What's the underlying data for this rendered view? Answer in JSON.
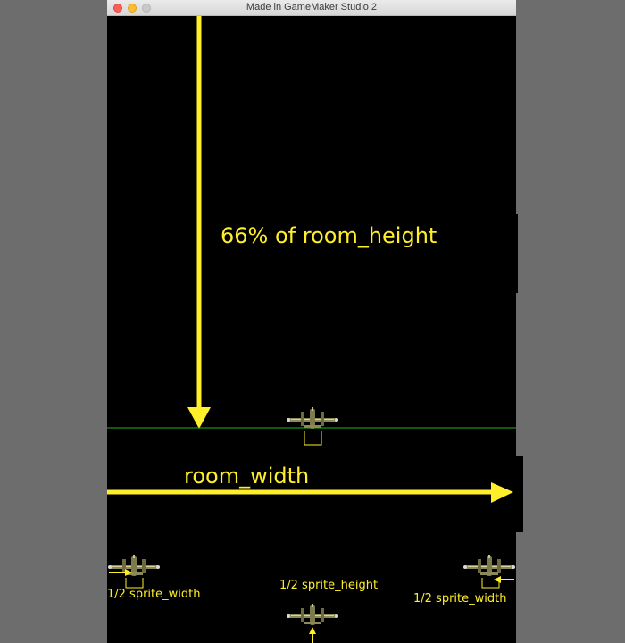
{
  "window": {
    "title": "Made in GameMaker Studio 2"
  },
  "annotations": {
    "height_label": "66% of room_height",
    "width_label": "room_width",
    "half_sprite_width_left": "1/2 sprite_width",
    "half_sprite_height": "1/2 sprite_height",
    "half_sprite_width_right": "1/2 sprite_width"
  },
  "colors": {
    "annotation": "#ffef2a",
    "guide_line": "#1fb41f",
    "canvas": "#000000",
    "backdrop": "#6d6d6d"
  },
  "sprites": {
    "icon": "plane-sprite-icon"
  }
}
